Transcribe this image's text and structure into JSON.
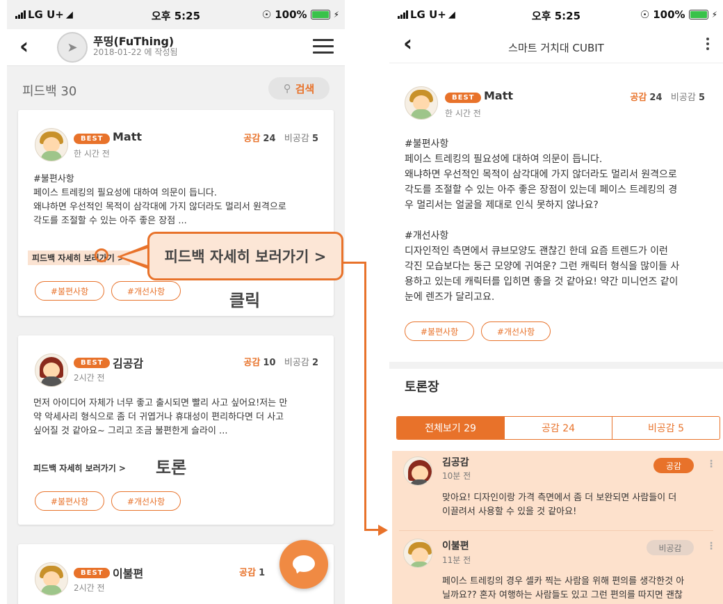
{
  "status": {
    "carrier": "LG U+",
    "time": "오후 5:25",
    "battery": "100%"
  },
  "left": {
    "brand_name": "푸띵(FuThing)",
    "brand_date": "2018-01-22 에 작성됨",
    "feedback_title": "피드백 30",
    "search_label": "검색",
    "cards": [
      {
        "badge": "BEST",
        "name": "Matt",
        "time": "한 시간 전",
        "agree_label": "공감",
        "agree_count": "24",
        "disagree_label": "비공감",
        "disagree_count": "5",
        "body": [
          "#불편사항",
          "페이스 트레킹의 필요성에 대하여 의문이 듭니다.",
          "왜냐하면 우선적인 목적이 삼각대에 가지 않더라도 멀리서 원격으로",
          "각도를 조절할 수 있는 아주 좋은 장점 ..."
        ],
        "detail": "피드백 자세히 보러가기 >",
        "tags": [
          "#불편사항",
          "#개선사항"
        ]
      },
      {
        "badge": "BEST",
        "name": "김공감",
        "time": "2시간 전",
        "agree_label": "공감",
        "agree_count": "10",
        "disagree_label": "비공감",
        "disagree_count": "2",
        "body": [
          "먼저 아이디어 자체가 너무 좋고 출시되면 빨리 사고 싶어요!저는 만",
          "약 악세사리 형식으로 좀 더 귀엽거나 휴대성이 편리하다면 더 사고",
          "싶어질 것 같아요~ 그리고 조금 불편한게 슬라이 ..."
        ],
        "detail": "피드백 자세히 보러가기 >",
        "tags": [
          "#불편사항",
          "#개선사항"
        ]
      },
      {
        "badge": "BEST",
        "name": "이불편",
        "time": "2시간 전",
        "agree_label": "공감",
        "agree_count": "1"
      }
    ],
    "callout": "피드백 자세히 보러가기 >",
    "click_label": "클릭"
  },
  "right": {
    "title": "스마트 거치대 CUBIT",
    "post": {
      "badge": "BEST",
      "name": "Matt",
      "time": "한 시간 전",
      "agree_label": "공감",
      "agree_count": "24",
      "disagree_label": "비공감",
      "disagree_count": "5",
      "body1": [
        "#불편사항",
        "페이스 트레킹의 필요성에 대하여 의문이 듭니다.",
        "왜냐하면 우선적인 목적이 삼각대에 가지 않더라도 멀리서 원격으로",
        "각도를 조절할 수 있는 아주 좋은 장점이 있는데 페이스 트레킹의 경",
        "우 멀리서는 얼굴을 제대로 인식 못하지 않나요?"
      ],
      "body2": [
        "#개선사항",
        "디자인적인 측면에서 큐브모양도 괜찮긴 한데 요즘 트렌드가 이런",
        "각진 모습보다는 둥근 모양에 귀여운? 그런 캐릭터 형식을 많이들 사",
        "용하고 있는데 캐릭터를 입히면 좋을 것 같아요! 약간 미니언즈 같이",
        "눈에 렌즈가 달리고요."
      ],
      "tags": [
        "#불편사항",
        "#개선사항"
      ]
    },
    "discussion_title": "토론장",
    "tabs": [
      "전체보기 29",
      "공감 24",
      "비공감 5"
    ],
    "toron_label": "토론",
    "comments": [
      {
        "name": "김공감",
        "time": "10분 전",
        "stance": "공감",
        "body": [
          "맞아요! 디자인이랑 가격 측면에서 좀 더 보완되면 사람들이 더",
          "이끌려서 사용할 수 있을 것 같아요!"
        ]
      },
      {
        "name": "이불편",
        "time": "11분 전",
        "stance": "비공감",
        "body": [
          "페이스 트레킹의 경우 셀카 찍는 사람을 위해 편의를 생각한것 아",
          "닐까요?? 혼자 여행하는 사람들도 있고 그런 편의를 따지면 괜찮"
        ]
      }
    ]
  },
  "colors": {
    "accent": "#e8722a",
    "highlight": "#fde1cc"
  },
  "icons": [
    "back-icon",
    "menu-icon",
    "search-icon",
    "more-icon",
    "chat-icon",
    "wifi-icon",
    "battery-icon"
  ]
}
